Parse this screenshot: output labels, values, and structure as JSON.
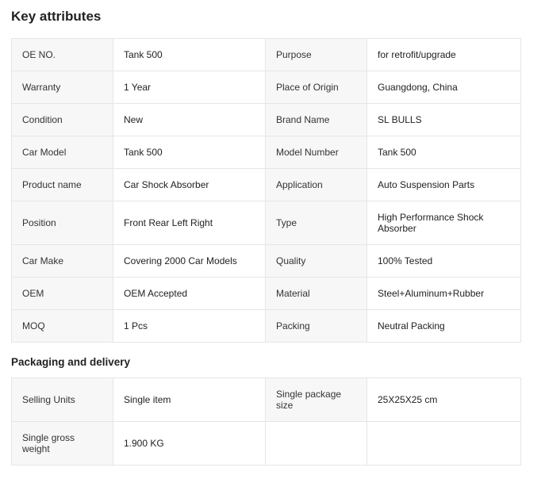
{
  "key_attributes": {
    "title": "Key attributes",
    "rows": [
      [
        {
          "k": "OE NO.",
          "v": "Tank 500"
        },
        {
          "k": "Purpose",
          "v": "for retrofit/upgrade"
        }
      ],
      [
        {
          "k": "Warranty",
          "v": "1 Year"
        },
        {
          "k": "Place of Origin",
          "v": "Guangdong, China"
        }
      ],
      [
        {
          "k": "Condition",
          "v": "New"
        },
        {
          "k": "Brand Name",
          "v": "SL BULLS"
        }
      ],
      [
        {
          "k": "Car Model",
          "v": "Tank 500"
        },
        {
          "k": "Model Number",
          "v": "Tank 500"
        }
      ],
      [
        {
          "k": "Product name",
          "v": "Car Shock Absorber"
        },
        {
          "k": "Application",
          "v": "Auto Suspension Parts"
        }
      ],
      [
        {
          "k": "Position",
          "v": "Front Rear Left Right"
        },
        {
          "k": "Type",
          "v": "High Performance Shock Absorber"
        }
      ],
      [
        {
          "k": "Car Make",
          "v": "Covering 2000 Car Models"
        },
        {
          "k": "Quality",
          "v": "100% Tested"
        }
      ],
      [
        {
          "k": "OEM",
          "v": "OEM Accepted"
        },
        {
          "k": "Material",
          "v": "Steel+Aluminum+Rubber"
        }
      ],
      [
        {
          "k": "MOQ",
          "v": "1 Pcs"
        },
        {
          "k": "Packing",
          "v": "Neutral Packing"
        }
      ]
    ]
  },
  "packaging": {
    "title": "Packaging and delivery",
    "rows": [
      [
        {
          "k": "Selling Units",
          "v": "Single item"
        },
        {
          "k": "Single package size",
          "v": "25X25X25 cm"
        }
      ],
      [
        {
          "k": "Single gross weight",
          "v": "1.900 KG"
        }
      ]
    ]
  }
}
